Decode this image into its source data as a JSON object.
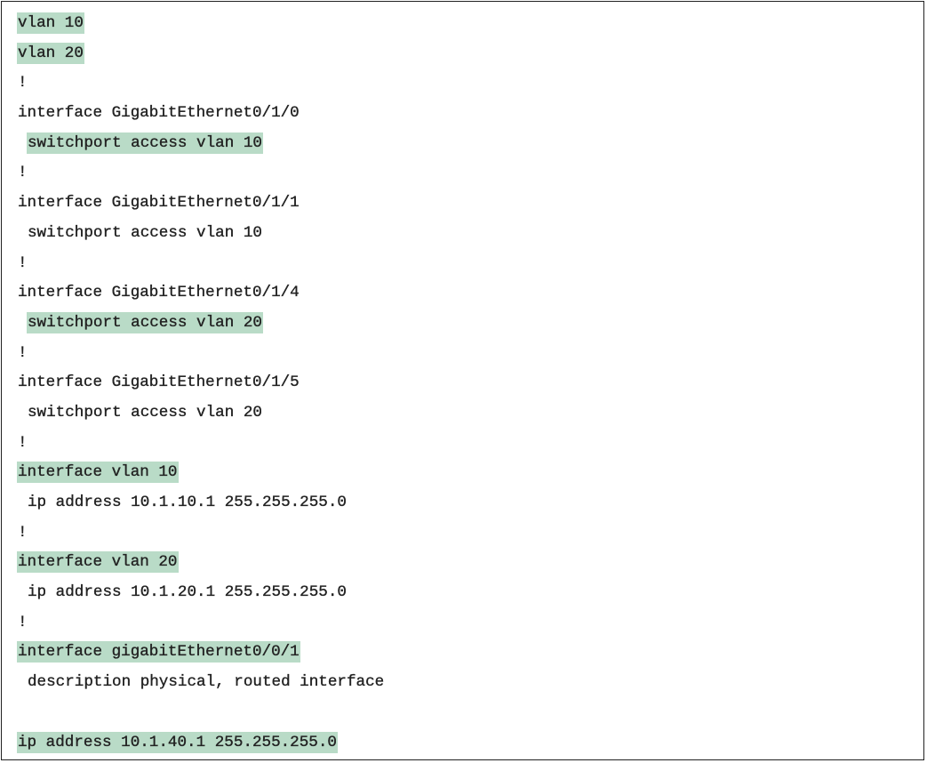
{
  "document": {
    "highlight_color": "#b9dbc7",
    "lines": [
      {
        "indent": false,
        "text": "vlan 10",
        "highlighted": true
      },
      {
        "indent": false,
        "text": "vlan 20",
        "highlighted": true
      },
      {
        "indent": false,
        "text": "!",
        "highlighted": false
      },
      {
        "indent": false,
        "text": "interface GigabitEthernet0/1/0",
        "highlighted": false
      },
      {
        "indent": true,
        "text": "switchport access vlan 10",
        "highlighted": true
      },
      {
        "indent": false,
        "text": "!",
        "highlighted": false
      },
      {
        "indent": false,
        "text": "interface GigabitEthernet0/1/1",
        "highlighted": false
      },
      {
        "indent": true,
        "text": "switchport access vlan 10",
        "highlighted": false
      },
      {
        "indent": false,
        "text": "!",
        "highlighted": false
      },
      {
        "indent": false,
        "text": "interface GigabitEthernet0/1/4",
        "highlighted": false
      },
      {
        "indent": true,
        "text": "switchport access vlan 20",
        "highlighted": true
      },
      {
        "indent": false,
        "text": "!",
        "highlighted": false
      },
      {
        "indent": false,
        "text": "interface GigabitEthernet0/1/5",
        "highlighted": false
      },
      {
        "indent": true,
        "text": "switchport access vlan 20",
        "highlighted": false
      },
      {
        "indent": false,
        "text": "!",
        "highlighted": false
      },
      {
        "indent": false,
        "text": "interface vlan 10",
        "highlighted": true
      },
      {
        "indent": true,
        "text": "ip address 10.1.10.1 255.255.255.0",
        "highlighted": false
      },
      {
        "indent": false,
        "text": "!",
        "highlighted": false
      },
      {
        "indent": false,
        "text": "interface vlan 20",
        "highlighted": true
      },
      {
        "indent": true,
        "text": "ip address 10.1.20.1 255.255.255.0",
        "highlighted": false
      },
      {
        "indent": false,
        "text": "!",
        "highlighted": false
      },
      {
        "indent": false,
        "text": "interface gigabitEthernet0/0/1",
        "highlighted": true
      },
      {
        "indent": true,
        "text": "description physical, routed interface",
        "highlighted": false
      },
      {
        "indent": false,
        "text": "",
        "highlighted": false
      },
      {
        "indent": false,
        "text": "ip address 10.1.40.1 255.255.255.0",
        "highlighted": true
      }
    ]
  }
}
